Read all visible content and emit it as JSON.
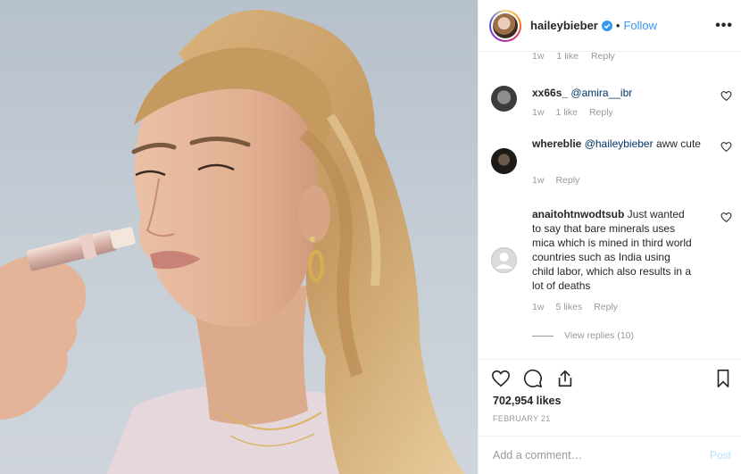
{
  "header": {
    "username": "haileybieber",
    "separator": "•",
    "follow_label": "Follow",
    "more_icon": "•••"
  },
  "comments": {
    "partial_top": {
      "time": "1w",
      "likes": "1 like",
      "reply_label": "Reply"
    },
    "items": [
      {
        "username": "xx66s_",
        "mention": "@amira__ibr",
        "text": "",
        "time": "1w",
        "likes": "1 like",
        "reply_label": "Reply"
      },
      {
        "username": "whereblie",
        "mention": "@haileybieber",
        "text": " aww cute",
        "time": "1w",
        "likes": "",
        "reply_label": "Reply"
      },
      {
        "username": "anaitohtnwodtsub",
        "mention": "",
        "text": " Just wanted to say that bare minerals uses mica which is mined in third world countries such as India using child labor, which also results in a lot of deaths",
        "time": "1w",
        "likes": "5 likes",
        "reply_label": "Reply"
      }
    ],
    "view_replies_label": "View replies (10)"
  },
  "actions": {
    "like_icon": "heart-icon",
    "comment_icon": "comment-icon",
    "share_icon": "share-icon",
    "save_icon": "bookmark-icon"
  },
  "likes_count": "702,954 likes",
  "post_date": "February 21",
  "add_comment": {
    "placeholder": "Add a comment…",
    "post_label": "Post"
  },
  "colors": {
    "accent_blue": "#3897f0",
    "mention_blue": "#003569",
    "muted_gray": "#999999",
    "post_disabled": "#b2dffc",
    "verified_blue": "#3897f0"
  }
}
